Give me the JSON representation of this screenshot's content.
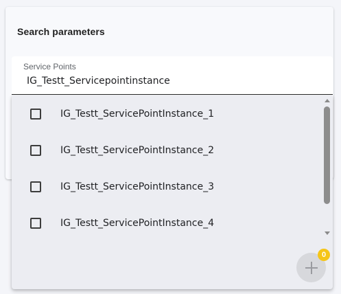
{
  "card": {
    "title": "Search parameters"
  },
  "service_points": {
    "label": "Service Points",
    "value": "IG_Testt_Servicepointinstance",
    "options": [
      {
        "label": "IG_Testt_ServicePointInstance_1",
        "checked": false
      },
      {
        "label": "IG_Testt_ServicePointInstance_2",
        "checked": false
      },
      {
        "label": "IG_Testt_ServicePointInstance_3",
        "checked": false
      },
      {
        "label": "IG_Testt_ServicePointInstance_4",
        "checked": false
      }
    ]
  },
  "fab": {
    "icon": "plus-icon",
    "badge_count": "0"
  },
  "colors": {
    "badge": "#f5c518",
    "panel_bg": "#ecedf2",
    "field_bg": "#ffffff",
    "scroll_thumb": "#8d8d8d"
  }
}
